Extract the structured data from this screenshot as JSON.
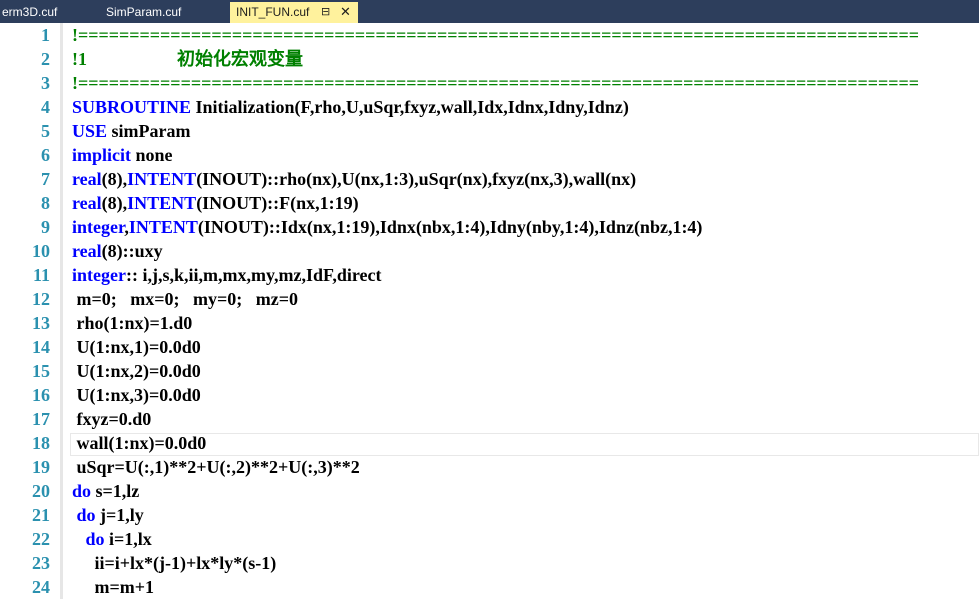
{
  "tabs": [
    {
      "label": "erm3D.cuf"
    },
    {
      "label": "SimParam.cuf"
    },
    {
      "label": "INIT_FUN.cuf",
      "active": true,
      "pin_icon": "pin-icon",
      "close_icon": "close-icon"
    }
  ],
  "colors": {
    "tabbar": "#2d3e5c",
    "active_tab": "#fff29d",
    "keyword": "#0000ff",
    "comment": "#008000",
    "line_number": "#2b91af"
  },
  "editor": {
    "line_numbers": [
      "1",
      "2",
      "3",
      "4",
      "5",
      "6",
      "7",
      "8",
      "9",
      "10",
      "11",
      "12",
      "13",
      "14",
      "15",
      "16",
      "17",
      "18",
      "19",
      "20",
      "21",
      "22",
      "23",
      "24"
    ],
    "lines": [
      {
        "segments": [
          {
            "t": "c",
            "v": "!=================================================================================="
          }
        ]
      },
      {
        "segments": [
          {
            "t": "c",
            "v": "!1                    初始化宏观变量"
          }
        ]
      },
      {
        "segments": [
          {
            "t": "c",
            "v": "!=================================================================================="
          }
        ]
      },
      {
        "segments": [
          {
            "t": "k",
            "v": "SUBROUTINE"
          },
          {
            "t": "p",
            "v": " Initialization(F,rho,U,uSqr,fxyz,wall,Idx,Idnx,Idny,Idnz)"
          }
        ]
      },
      {
        "segments": [
          {
            "t": "k",
            "v": "USE"
          },
          {
            "t": "p",
            "v": " simParam"
          }
        ]
      },
      {
        "segments": [
          {
            "t": "k",
            "v": "implicit"
          },
          {
            "t": "p",
            "v": " none"
          }
        ]
      },
      {
        "segments": [
          {
            "t": "k",
            "v": "real"
          },
          {
            "t": "p",
            "v": "(8),"
          },
          {
            "t": "k",
            "v": "INTENT"
          },
          {
            "t": "p",
            "v": "(INOUT)::rho(nx),U(nx,1:3),uSqr(nx),fxyz(nx,3),wall(nx)"
          }
        ]
      },
      {
        "segments": [
          {
            "t": "k",
            "v": "real"
          },
          {
            "t": "p",
            "v": "(8),"
          },
          {
            "t": "k",
            "v": "INTENT"
          },
          {
            "t": "p",
            "v": "(INOUT)::F(nx,1:19)"
          }
        ]
      },
      {
        "segments": [
          {
            "t": "k",
            "v": "integer"
          },
          {
            "t": "p",
            "v": ","
          },
          {
            "t": "k",
            "v": "INTENT"
          },
          {
            "t": "p",
            "v": "(INOUT)::Idx(nx,1:19),Idnx(nbx,1:4),Idny(nby,1:4),Idnz(nbz,1:4)"
          }
        ]
      },
      {
        "segments": [
          {
            "t": "k",
            "v": "real"
          },
          {
            "t": "p",
            "v": "(8)::uxy"
          }
        ]
      },
      {
        "segments": [
          {
            "t": "k",
            "v": "integer"
          },
          {
            "t": "p",
            "v": ":: i,j,s,k,ii,m,mx,my,mz,IdF,direct"
          }
        ]
      },
      {
        "segments": [
          {
            "t": "p",
            "v": " m=0;   mx=0;   my=0;   mz=0"
          }
        ]
      },
      {
        "segments": [
          {
            "t": "p",
            "v": " rho(1:nx)=1.d0"
          }
        ]
      },
      {
        "segments": [
          {
            "t": "p",
            "v": " U(1:nx,1)=0.0d0"
          }
        ]
      },
      {
        "segments": [
          {
            "t": "p",
            "v": " U(1:nx,2)=0.0d0"
          }
        ]
      },
      {
        "segments": [
          {
            "t": "p",
            "v": " U(1:nx,3)=0.0d0"
          }
        ]
      },
      {
        "segments": [
          {
            "t": "p",
            "v": " fxyz=0.d0"
          }
        ]
      },
      {
        "segments": [
          {
            "t": "p",
            "v": " wall(1:nx)=0.0d0"
          }
        ]
      },
      {
        "segments": [
          {
            "t": "p",
            "v": " uSqr=U(:,1)**2+U(:,2)**2+U(:,3)**2"
          }
        ]
      },
      {
        "segments": [
          {
            "t": "k",
            "v": "do"
          },
          {
            "t": "p",
            "v": " s=1,lz"
          }
        ]
      },
      {
        "segments": [
          {
            "t": "p",
            "v": " "
          },
          {
            "t": "k",
            "v": "do"
          },
          {
            "t": "p",
            "v": " j=1,ly"
          }
        ]
      },
      {
        "segments": [
          {
            "t": "p",
            "v": "   "
          },
          {
            "t": "k",
            "v": "do"
          },
          {
            "t": "p",
            "v": " i=1,lx"
          }
        ]
      },
      {
        "segments": [
          {
            "t": "p",
            "v": "     ii=i+lx*(j-1)+lx*ly*(s-1)"
          }
        ]
      },
      {
        "segments": [
          {
            "t": "p",
            "v": "     m=m+1"
          }
        ]
      }
    ]
  }
}
